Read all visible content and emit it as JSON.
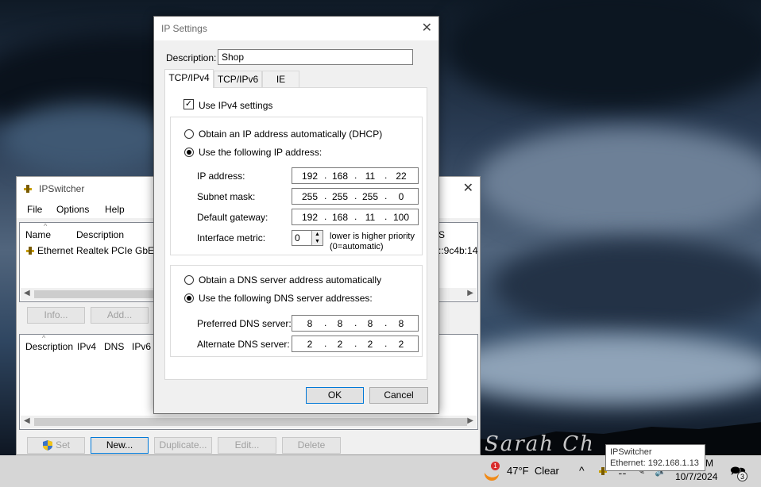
{
  "desktop": {
    "signature": "Sarah Ch"
  },
  "ipswitcher": {
    "title": "IPSwitcher",
    "close": "✕",
    "menu": [
      "File",
      "Options",
      "Help"
    ],
    "adapters": {
      "columns": [
        "Name",
        "Description"
      ],
      "rows": [
        {
          "name": "Ethernet",
          "description": "Realtek PCIe GbE Fa",
          "extra": "::9c4b:14"
        }
      ],
      "partial_col": "S"
    },
    "mid_buttons": {
      "info": "Info...",
      "add": "Add..."
    },
    "profiles": {
      "columns": [
        "Description",
        "IPv4",
        "DNS",
        "IPv6"
      ]
    },
    "bottom_buttons": {
      "set": "Set",
      "new": "New...",
      "duplicate": "Duplicate...",
      "edit": "Edit...",
      "delete": "Delete"
    }
  },
  "dialog": {
    "title": "IP Settings",
    "close": "✕",
    "description_label": "Description:",
    "description_value": "Shop",
    "tabs": [
      "TCP/IPv4",
      "TCP/IPv6",
      "IE Proxy"
    ],
    "use_ipv4": {
      "label": "Use IPv4 settings",
      "checked": true
    },
    "ip_mode": {
      "auto_label": "Obtain an IP address automatically (DHCP)",
      "manual_label": "Use the following IP address:",
      "selected": "manual"
    },
    "ip_address": {
      "label": "IP address:",
      "octets": [
        "192",
        "168",
        "11",
        "22"
      ]
    },
    "subnet_mask": {
      "label": "Subnet mask:",
      "octets": [
        "255",
        "255",
        "255",
        "0"
      ]
    },
    "gateway": {
      "label": "Default gateway:",
      "octets": [
        "192",
        "168",
        "11",
        "100"
      ]
    },
    "metric": {
      "label": "Interface metric:",
      "value": "0",
      "hint1": "lower is higher priority",
      "hint2": "(0=automatic)"
    },
    "dns_mode": {
      "auto_label": "Obtain a DNS server address automatically",
      "manual_label": "Use the following DNS server addresses:",
      "selected": "manual"
    },
    "preferred_dns": {
      "label": "Preferred DNS server:",
      "octets": [
        "8",
        "8",
        "8",
        "8"
      ]
    },
    "alternate_dns": {
      "label": "Alternate DNS server:",
      "octets": [
        "2",
        "2",
        "2",
        "2"
      ]
    },
    "ok": "OK",
    "cancel": "Cancel"
  },
  "taskbar": {
    "weather_badge": "1",
    "weather": "47°F  Clear",
    "chevron": "^",
    "time_partial": "M",
    "date": "10/7/2024",
    "notif_count": "3"
  },
  "tooltip": {
    "line1": "IPSwitcher",
    "line2": "Ethernet: 192.168.1.13"
  }
}
